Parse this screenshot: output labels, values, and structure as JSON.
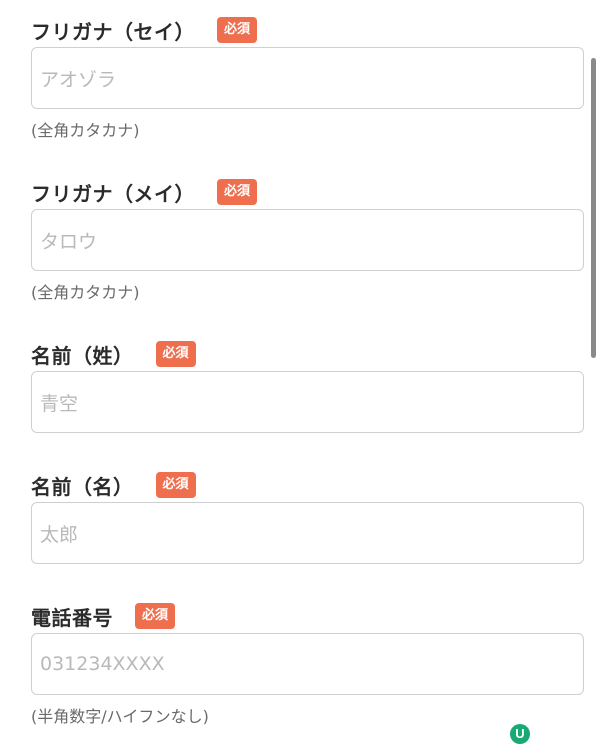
{
  "required_badge": "必須",
  "fields": [
    {
      "label": "フリガナ（セイ）",
      "placeholder": "アオゾラ",
      "hint": "(全角カタカナ)"
    },
    {
      "label": "フリガナ（メイ）",
      "placeholder": "タロウ",
      "hint": "(全角カタカナ)"
    },
    {
      "label": "名前（姓）",
      "placeholder": "青空",
      "hint": ""
    },
    {
      "label": "名前（名）",
      "placeholder": "太郎",
      "hint": ""
    },
    {
      "label": "電話番号",
      "placeholder": "031234XXXX",
      "hint": "(半角数字/ハイフンなし)"
    }
  ],
  "floating_widget": {
    "icon": "u-logo-icon",
    "letter": "U",
    "color": "#19a974"
  },
  "colors": {
    "badge": "#ef6e4d",
    "border": "#cfcfcf",
    "placeholder": "#b9b9b9"
  }
}
